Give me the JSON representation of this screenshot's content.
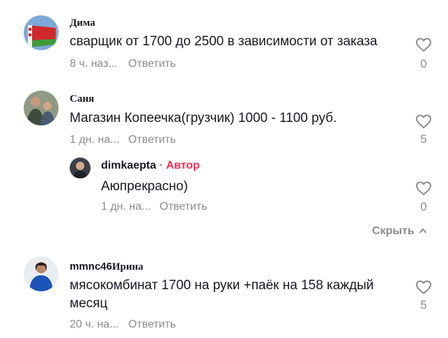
{
  "comments": [
    {
      "username": "Дима",
      "text": "сварщик от 1700 до 2500 в зависимости от заказа",
      "time": "8 ч. наз...",
      "reply": "Ответить",
      "likes": "0"
    },
    {
      "username": "Саня",
      "text": "Магазин Копеечка(грузчик) 1000 - 1100 руб.",
      "time": "1 дн. на...",
      "reply": "Ответить",
      "likes": "5"
    },
    {
      "username": "mmnc46",
      "username_suffix": "Ирина",
      "text_line1": "мясокомбинат 1700 на руки +паёк на 158 каждый",
      "text_line2": "месяц",
      "time": "20 ч. на...",
      "reply": "Ответить",
      "likes": "5"
    }
  ],
  "reply": {
    "username": "dimkaepta",
    "separator": " · ",
    "author_badge": "Автор",
    "text": "Аюпрекрасно)",
    "time": "1 дн. на...",
    "reply": "Ответить",
    "likes": "0"
  },
  "hide_label": "Скрыть",
  "colors": {
    "author": "#fe2c55",
    "meta": "#8a8b91",
    "text": "#161823"
  },
  "icons": {
    "like": "heart-outline-icon",
    "hide": "chevron-up-icon"
  }
}
